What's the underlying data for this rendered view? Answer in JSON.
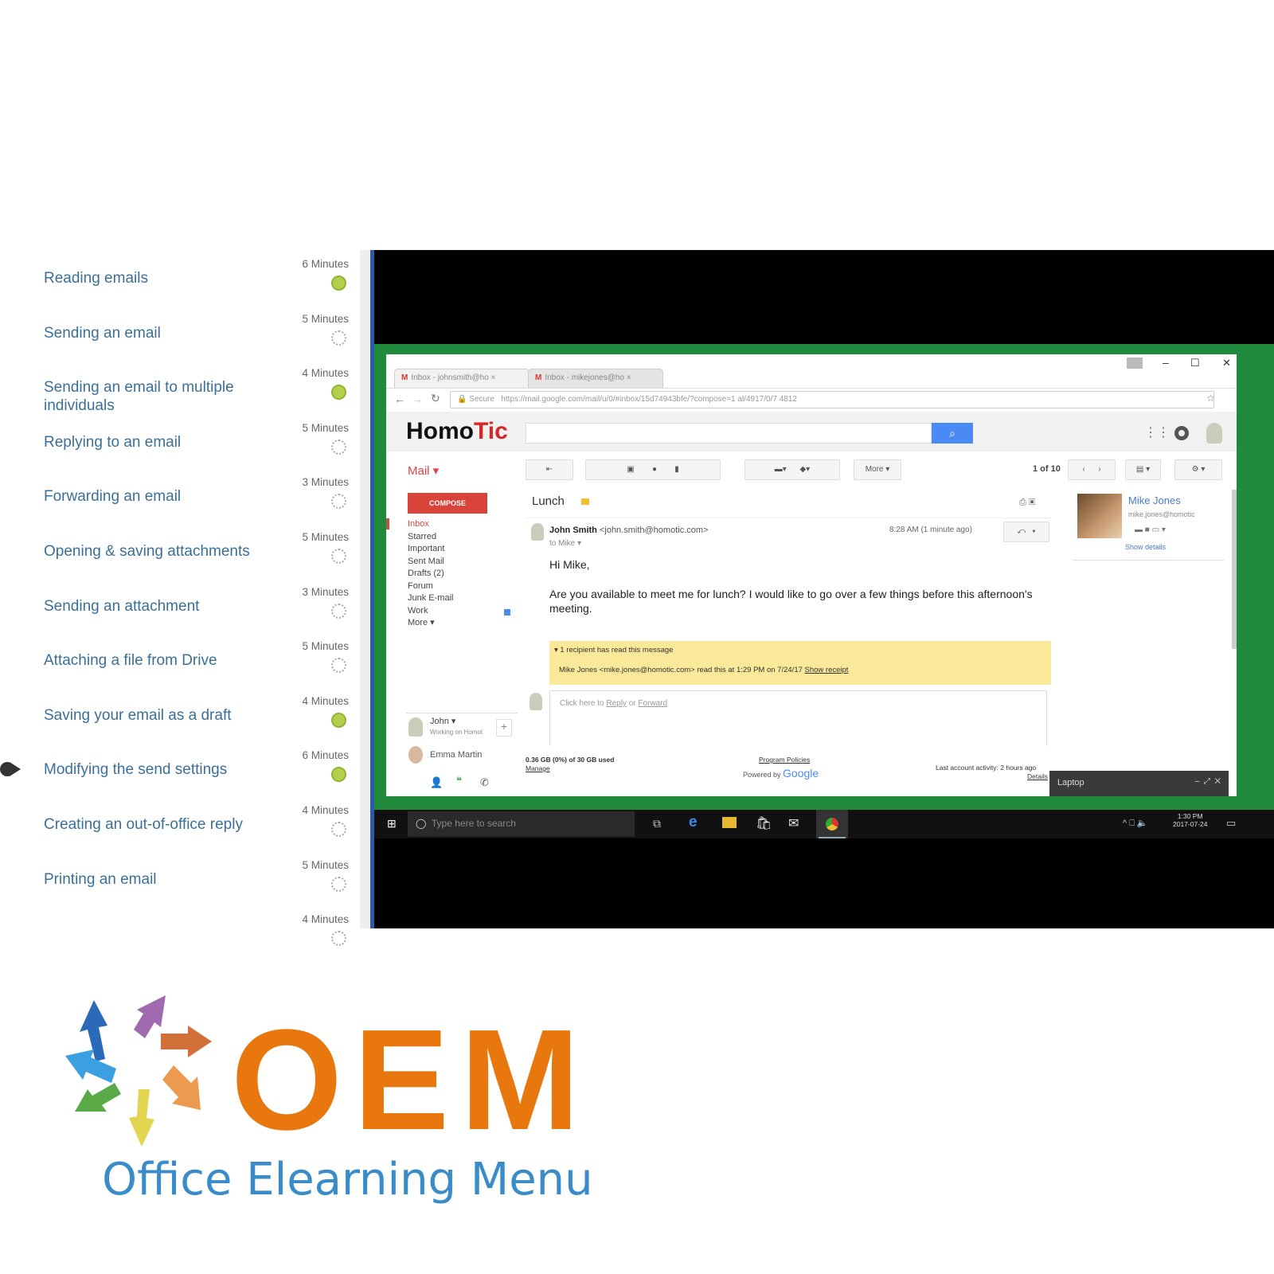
{
  "lessons": [
    {
      "title": "Reading emails",
      "duration": "6 Minutes",
      "status": "completed"
    },
    {
      "title": "Sending an email",
      "duration": "5 Minutes",
      "status": "not-started"
    },
    {
      "title": "Sending an email to multiple individuals",
      "duration": "4 Minutes",
      "status": "completed"
    },
    {
      "title": "Replying to an email",
      "duration": "5 Minutes",
      "status": "not-started"
    },
    {
      "title": "Forwarding an email",
      "duration": "3 Minutes",
      "status": "not-started"
    },
    {
      "title": "Opening & saving attachments",
      "duration": "5 Minutes",
      "status": "not-started"
    },
    {
      "title": "Sending an attachment",
      "duration": "3 Minutes",
      "status": "not-started"
    },
    {
      "title": "Attaching a file from Drive",
      "duration": "5 Minutes",
      "status": "not-started"
    },
    {
      "title": "Saving your email as a draft",
      "duration": "4 Minutes",
      "status": "completed"
    },
    {
      "title": "Modifying the send settings",
      "duration": "6 Minutes",
      "status": "completed",
      "current": true
    },
    {
      "title": "Creating an out-of-office reply",
      "duration": "4 Minutes",
      "status": "not-started"
    },
    {
      "title": "Printing an email",
      "duration": "5 Minutes",
      "status": "not-started"
    },
    {
      "title": "",
      "duration": "4 Minutes",
      "status": "not-started"
    }
  ],
  "browser": {
    "tabs": [
      "Inbox - johnsmith@ho",
      "Inbox - mikejones@ho"
    ],
    "secure": "Secure",
    "url": "https://mail.google.com/mail/u/0/#inbox/15d74943bfe/?compose=1 al/4917/0/7 4812"
  },
  "gmail": {
    "logo_dark": "Homo",
    "logo_red": "Tic",
    "mail_label": "Mail ▾",
    "compose": "COMPOSE",
    "folders": [
      "Inbox",
      "Starred",
      "Important",
      "Sent Mail",
      "Drafts (2)",
      "Forum",
      "Junk E-mail",
      "Work",
      "More ▾"
    ],
    "more": "More ▾",
    "pager": "1 of 10",
    "subject": "Lunch",
    "sender_name": "John Smith",
    "sender_email": "<john.smith@homotic.com>",
    "to": "to Mike ▾",
    "time": "8:28 AM (1 minute ago)",
    "greeting": "Hi Mike,",
    "body": "Are you available to meet me for lunch? I would like to go over a few things before this afternoon's meeting.",
    "receipt_header": "▾ 1 recipient has read this message",
    "receipt_text": "Mike Jones <mike.jones@homotic.com> read this at 1:29 PM on 7/24/17",
    "receipt_link": "Show receipt",
    "reply_prompt": "Click here to",
    "reply_link": "Reply",
    "or": "or",
    "forward_link": "Forward",
    "storage": "0.36 GB (0%) of 30 GB used",
    "manage": "Manage",
    "policies": "Program Policies",
    "powered": "Powered by",
    "google": "Google",
    "activity": "Last account activity: 2 hours ago",
    "details": "Details",
    "contact_name": "Mike Jones",
    "contact_email": "mike.jones@homotic",
    "show_details": "Show details",
    "chat": [
      {
        "name": "John ▾",
        "status": "Working on Homot"
      },
      {
        "name": "Emma Martin",
        "status": ""
      }
    ],
    "chat_window": "Laptop"
  },
  "taskbar": {
    "search": "Type here to search",
    "time": "1:30 PM",
    "date": "2017-07-24"
  },
  "logo": {
    "text": "OEM",
    "tagline": "Office Elearning Menu"
  },
  "colors": {
    "accent": "#2a5aa8",
    "completed": "#b6cf48",
    "lesson_text": "#3a6f9a",
    "logo_orange": "#e8780e",
    "logo_blue": "#3a8cc8",
    "frame_green": "#1f8a3b"
  }
}
